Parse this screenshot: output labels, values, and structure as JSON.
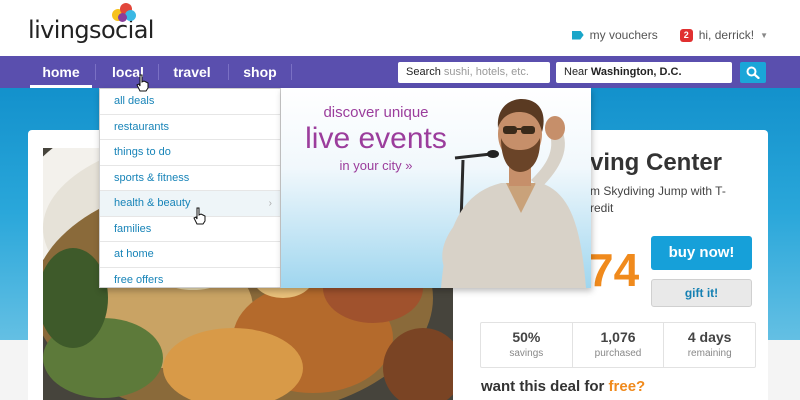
{
  "header": {
    "logo_text": "livingsocial",
    "logo_colors": [
      "#f7c21c",
      "#e2473b",
      "#3bb8e4",
      "#8a3e9c"
    ],
    "links": [
      {
        "icon": "tag-icon",
        "label": "my vouchers"
      },
      {
        "badge": "2",
        "label": "hi, derrick!"
      }
    ]
  },
  "nav": {
    "items": [
      {
        "label": "home",
        "active": true
      },
      {
        "label": "local",
        "active": false
      },
      {
        "label": "travel",
        "active": false
      },
      {
        "label": "shop",
        "active": false
      }
    ],
    "search": {
      "prefix": "Search",
      "placeholder": "sushi, hotels, etc."
    },
    "location": {
      "prefix": "Near",
      "value": "Washington, D.C."
    },
    "search_button_icon": "search-icon",
    "color": "#5a4fae"
  },
  "dropdown": {
    "items": [
      "all deals",
      "restaurants",
      "things to do",
      "sports & fitness",
      "health & beauty",
      "families",
      "at home",
      "free offers"
    ],
    "hovered_index": 4
  },
  "promo": {
    "line1": "discover unique",
    "line2": "live events",
    "line3": "in your city »"
  },
  "deal": {
    "title": "ving Center",
    "subtitle": "m Skydiving Jump with T-\nredit",
    "price": "74",
    "buy_label": "buy now!",
    "gift_label": "gift it!",
    "stats": [
      {
        "value": "50%",
        "label": "savings"
      },
      {
        "value": "1,076",
        "label": "purchased"
      },
      {
        "value": "4 days",
        "label": "remaining"
      }
    ],
    "free_prefix": "want this deal for ",
    "free_word": "free?"
  },
  "colors": {
    "accent": "#1aa6d8",
    "price": "#f08a1c",
    "promo_text": "#9b3d9c"
  }
}
